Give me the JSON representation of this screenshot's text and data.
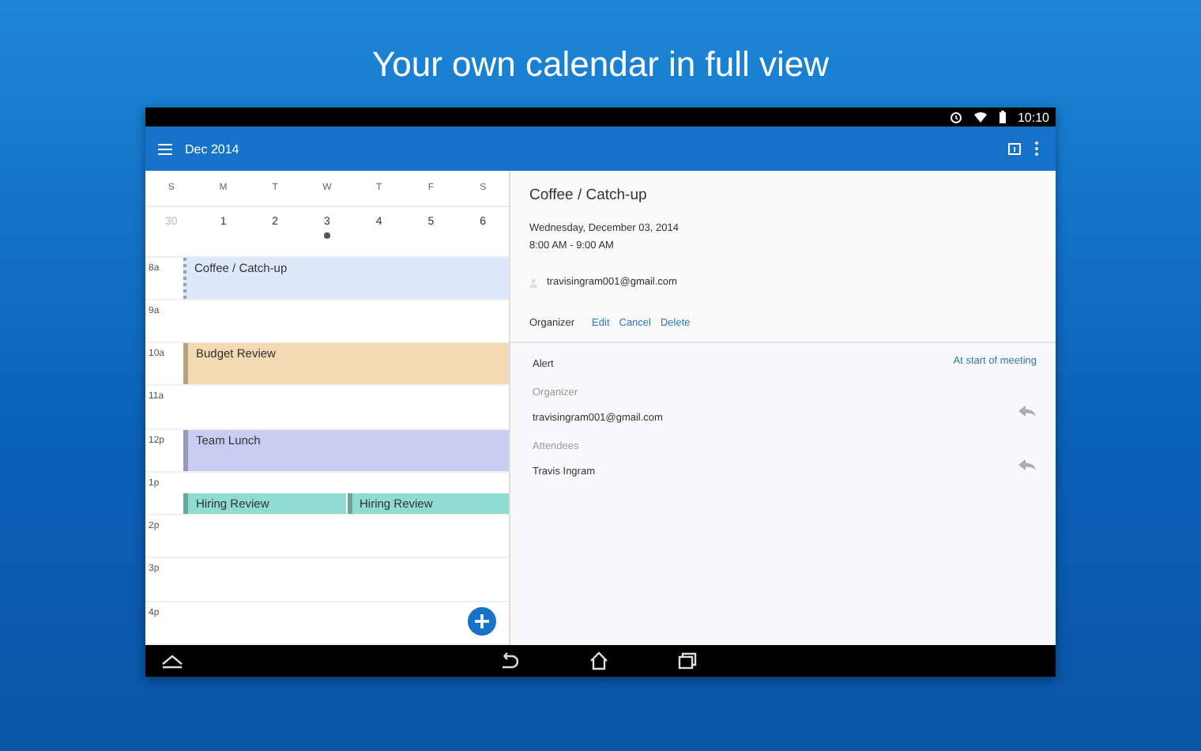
{
  "headline": "Your own calendar in full view",
  "status_bar": {
    "time": "10:10"
  },
  "app_bar": {
    "title": "Dec 2014"
  },
  "week": {
    "weekdays": [
      "S",
      "M",
      "T",
      "W",
      "T",
      "F",
      "S"
    ],
    "days": [
      {
        "label": "30",
        "muted": true,
        "has_events": false
      },
      {
        "label": "1",
        "muted": false,
        "has_events": false
      },
      {
        "label": "2",
        "muted": false,
        "has_events": false
      },
      {
        "label": "3",
        "muted": false,
        "has_events": true
      },
      {
        "label": "4",
        "muted": false,
        "has_events": false
      },
      {
        "label": "5",
        "muted": false,
        "has_events": false
      },
      {
        "label": "6",
        "muted": false,
        "has_events": false
      }
    ]
  },
  "hours": [
    {
      "label": "8a",
      "events": [
        {
          "title": "Coffee / Catch-up",
          "kind": "full",
          "color": "#dde9fb",
          "selected": true
        }
      ]
    },
    {
      "label": "9a"
    },
    {
      "label": "10a",
      "events": [
        {
          "title": "Budget Review",
          "kind": "full",
          "color": "#f2d9b2",
          "selected": false
        }
      ]
    },
    {
      "label": "11a"
    },
    {
      "label": "12p",
      "events": [
        {
          "title": "Team Lunch",
          "kind": "full",
          "color": "#c9cdf2",
          "selected": false
        }
      ]
    },
    {
      "label": "1p",
      "events": [
        {
          "title": "Hiring Review",
          "kind": "half",
          "color": "#8fdcd0",
          "selected": false
        },
        {
          "title": "Hiring Review",
          "kind": "half",
          "color": "#8fdcd0",
          "selected": false
        }
      ]
    },
    {
      "label": "2p"
    },
    {
      "label": "3p"
    },
    {
      "label": "4p"
    }
  ],
  "detail": {
    "title": "Coffee / Catch-up",
    "date": "Wednesday, December 03, 2014",
    "time": "8:00 AM - 9:00 AM",
    "calendar": "travisingram001@gmail.com",
    "role": "Organizer",
    "actions": [
      "Edit",
      "Cancel",
      "Delete"
    ],
    "alert_label": "Alert",
    "alert_value": "At start of meeting",
    "sections": [
      {
        "heading": "Organizer",
        "people": [
          "travisingram001@gmail.com"
        ]
      },
      {
        "heading": "Attendees",
        "people": [
          "Travis Ingram"
        ]
      }
    ]
  }
}
